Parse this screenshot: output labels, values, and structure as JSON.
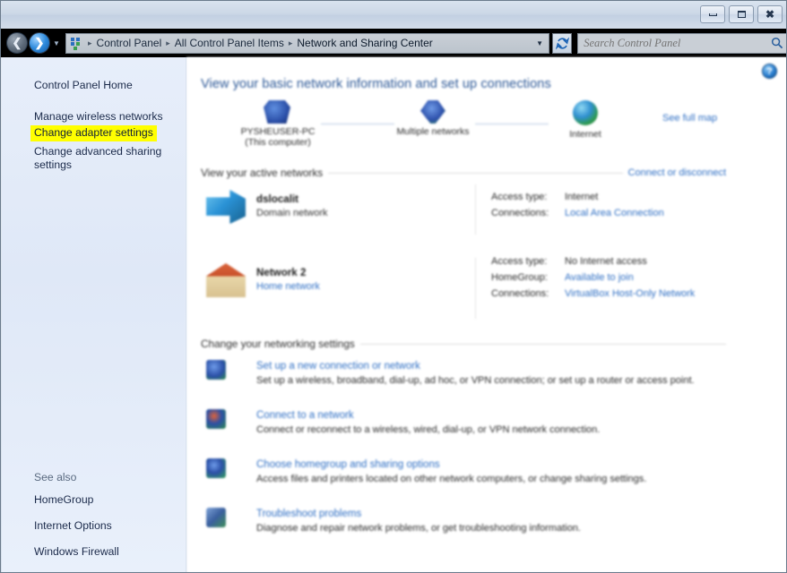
{
  "window": {
    "buttons": {
      "minimize": "Minimize",
      "maximize": "Maximize",
      "close": "Close"
    }
  },
  "nav": {
    "back": "Back",
    "forward": "Forward",
    "recent_pages": "Recent pages",
    "refresh": "Refresh",
    "breadcrumb": [
      "Control Panel",
      "All Control Panel Items",
      "Network and Sharing Center"
    ],
    "separator": "▸",
    "dropdown": "▼"
  },
  "search": {
    "placeholder": "Search Control Panel",
    "value": ""
  },
  "sidebar": {
    "home": "Control Panel Home",
    "wireless": "Manage wireless networks",
    "adapter": "Change adapter settings",
    "advanced": "Change advanced sharing settings",
    "see_also_label": "See also",
    "see_also": [
      "HomeGroup",
      "Internet Options",
      "Windows Firewall"
    ],
    "highlight_color": "#ffff00"
  },
  "content": {
    "help": "?",
    "heading": "View your basic network information and set up connections",
    "see_full_map": "See full map",
    "map": {
      "computer_name": "PYSHEUSER-PC",
      "computer_sub": "(This computer)",
      "middle": "Multiple networks",
      "internet": "Internet"
    },
    "active_networks": {
      "title": "View your active networks",
      "action": "Connect or disconnect",
      "rows": [
        {
          "name": "dslocalit",
          "sub": "Domain network",
          "sub_is_link": false,
          "fields": [
            {
              "key": "Access type:",
              "value": "Internet",
              "link": false
            },
            {
              "key": "Connections:",
              "value": "Local Area Connection",
              "link": true
            }
          ]
        },
        {
          "name": "Network 2",
          "sub": "Home network",
          "sub_is_link": true,
          "fields": [
            {
              "key": "Access type:",
              "value": "No Internet access",
              "link": false
            },
            {
              "key": "HomeGroup:",
              "value": "Available to join",
              "link": true
            },
            {
              "key": "Connections:",
              "value": "VirtualBox Host-Only Network",
              "link": true
            }
          ]
        }
      ]
    },
    "settings": {
      "title": "Change your networking settings",
      "tasks": [
        {
          "title": "Set up a new connection or network",
          "desc": "Set up a wireless, broadband, dial-up, ad hoc, or VPN connection; or set up a router or access point."
        },
        {
          "title": "Connect to a network",
          "desc": "Connect or reconnect to a wireless, wired, dial-up, or VPN network connection."
        },
        {
          "title": "Choose homegroup and sharing options",
          "desc": "Access files and printers located on other network computers, or change sharing settings."
        },
        {
          "title": "Troubleshoot problems",
          "desc": "Diagnose and repair network problems, or get troubleshooting information."
        }
      ]
    }
  }
}
